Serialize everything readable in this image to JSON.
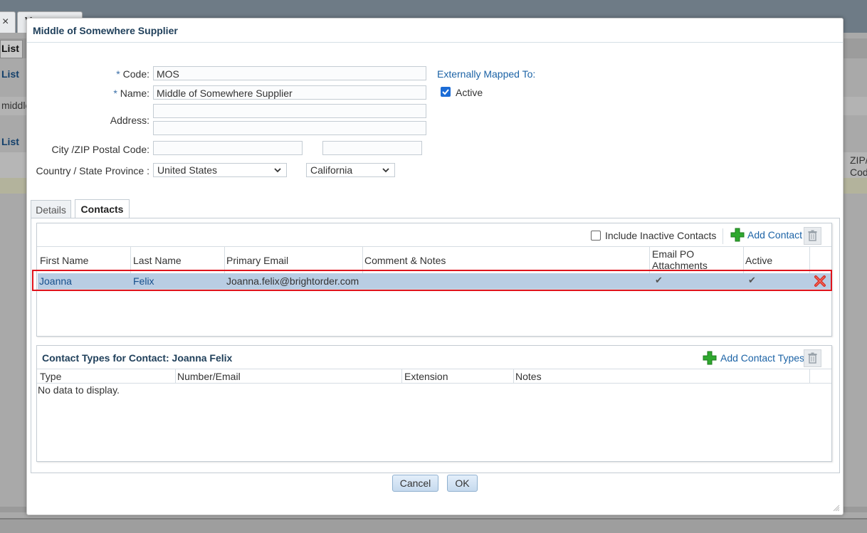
{
  "background": {
    "tab_label": "Ven",
    "close_glyph": "×",
    "list_tab": "List",
    "list_label_1": "List",
    "search_value": "middle",
    "list_label_2": "List",
    "zip_col_line1": "ZIP/",
    "zip_col_line2": "Cod"
  },
  "dialog": {
    "title": "Middle of Somewhere Supplier",
    "form": {
      "code_label": "Code:",
      "code_value": "MOS",
      "name_label": "Name:",
      "name_value": "Middle of Somewhere Supplier",
      "required_marker": "*",
      "address_label": "Address:",
      "address_line1": "",
      "address_line2": "",
      "city_zip_label": "City /ZIP Postal Code:",
      "city_value": "",
      "zip_value": "",
      "country_state_label": "Country / State Province :",
      "country_value": "United States",
      "state_value": "California",
      "externally_mapped_label": "Externally Mapped To:",
      "active_label": "Active",
      "active_checked": true
    },
    "tabs": [
      {
        "label": "Details",
        "active": false
      },
      {
        "label": "Contacts",
        "active": true
      }
    ],
    "contacts": {
      "include_inactive_label": "Include Inactive Contacts",
      "add_contact_label": "Add Contact",
      "columns": [
        "First Name",
        "Last Name",
        "Primary Email",
        "Comment & Notes",
        "Email PO Attachments",
        "Active"
      ],
      "rows": [
        {
          "first_name": "Joanna",
          "last_name": "Felix",
          "email": "Joanna.felix@brightorder.com",
          "comment": "",
          "email_po": "✔",
          "active": "✔"
        }
      ]
    },
    "contact_types": {
      "title": "Contact Types for Contact: Joanna Felix",
      "add_label": "Add Contact Types",
      "columns": [
        "Type",
        "Number/Email",
        "Extension",
        "Notes"
      ],
      "empty_text": "No data to display."
    },
    "buttons": {
      "cancel": "Cancel",
      "ok": "OK"
    }
  },
  "colors": {
    "selected_row": "#b9cde3",
    "highlight_box": "#e0141c",
    "link": "#1c63a6",
    "plus_green": "#2fa82f",
    "delete_red": "#d62b1f"
  },
  "icons": [
    "plus-icon",
    "trash-icon",
    "delete-x-icon",
    "chevron-down-icon",
    "check-icon",
    "resize-grip-icon"
  ]
}
